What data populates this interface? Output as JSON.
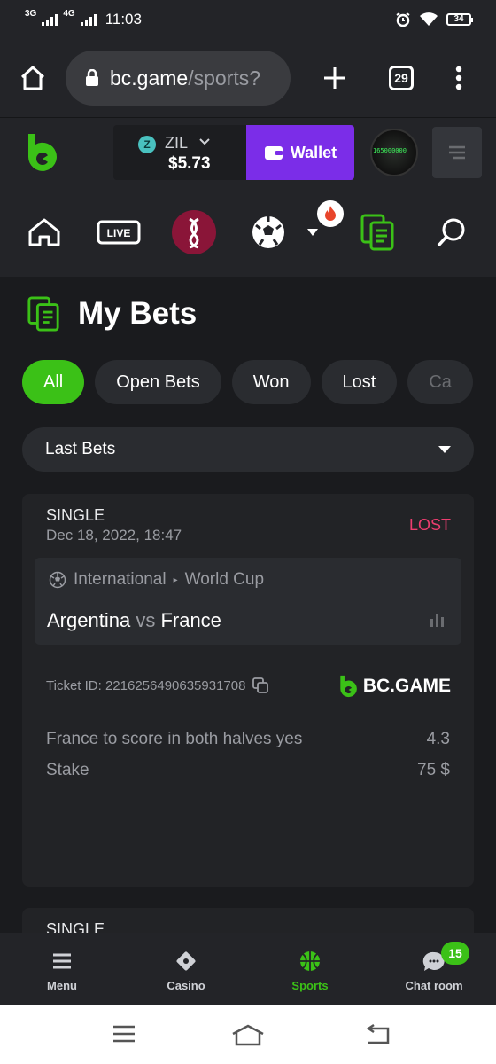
{
  "status": {
    "net1": "3G",
    "net2": "4G",
    "time": "11:03",
    "battery": "34"
  },
  "browser": {
    "url_host": "bc.game",
    "url_path": "/sports?",
    "tab_count": "29"
  },
  "header": {
    "currency": "ZIL",
    "balance": "$5.73",
    "wallet_label": "Wallet",
    "avatar_text": "165000000"
  },
  "page": {
    "title": "My Bets"
  },
  "filters": {
    "tabs": [
      "All",
      "Open Bets",
      "Won",
      "Lost",
      "Ca"
    ],
    "active": "All"
  },
  "dropdown": {
    "selected": "Last Bets"
  },
  "bet": {
    "type": "SINGLE",
    "date": "Dec 18, 2022, 18:47",
    "status": "LOST",
    "category": "International",
    "league": "World Cup",
    "home": "Argentina",
    "vs": "vs",
    "away": "France",
    "ticket": "Ticket ID: 221625649063593170​8",
    "brand": "BC.GAME",
    "selection": "France to score in both halves yes",
    "odds": "4.3",
    "stake_label": "Stake",
    "stake_value": "75 $"
  },
  "bet2": {
    "type": "SINGLE"
  },
  "bottom_nav": {
    "menu": "Menu",
    "casino": "Casino",
    "sports": "Sports",
    "chat": "Chat room",
    "chat_badge": "15"
  },
  "colors": {
    "accent_green": "#3bc117",
    "wallet_purple": "#7b2de8",
    "lost_red": "#ec3d6f"
  }
}
